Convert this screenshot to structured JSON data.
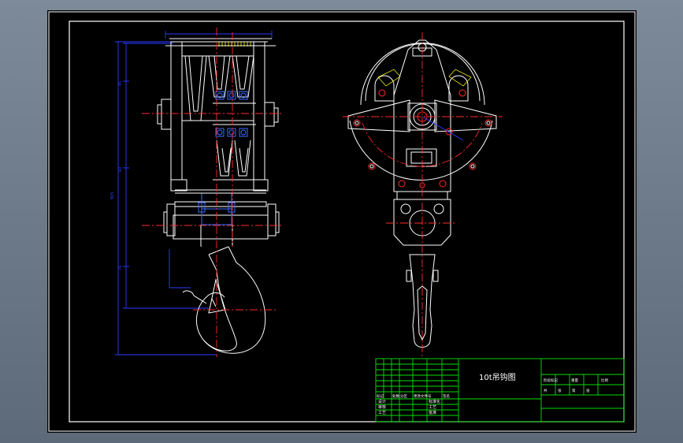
{
  "viewport": {
    "background": "#6e7b8a"
  },
  "sheet": {
    "background": "#000000",
    "frame_color": "#ffffff",
    "geometry_color": "#ffffff",
    "centerline_color": "#ff2a2a",
    "dimension_color": "#2a3dff",
    "section_color": "#3a6bff",
    "titleblock_color": "#00e000",
    "hatch_color": "#ffff00"
  },
  "title_block": {
    "drawing_title": "10t吊钩图",
    "left_rows": [
      [
        "标记",
        "处数",
        "分区",
        "更改文件号",
        "签名"
      ],
      [
        "设计",
        "",
        "",
        "标准化",
        ""
      ],
      [
        "审核",
        "",
        "",
        "工艺",
        ""
      ],
      [
        "工艺",
        "",
        "",
        "批准",
        ""
      ]
    ],
    "right_headers": [
      "阶段标记",
      "重量",
      "比例"
    ],
    "right_labels": [
      "共",
      "张",
      "第",
      "张"
    ]
  }
}
